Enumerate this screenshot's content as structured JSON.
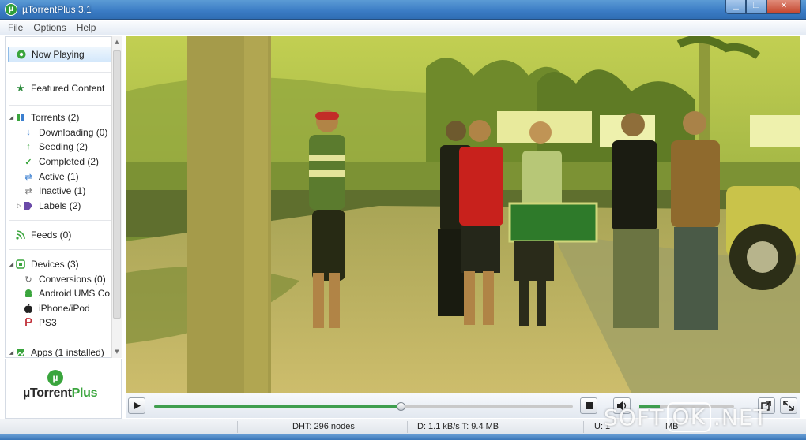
{
  "window": {
    "title": "µTorrentPlus 3.1",
    "app_icon": "utorrent-logo-icon"
  },
  "menu": [
    "File",
    "Options",
    "Help"
  ],
  "sidebar": {
    "now_playing": "Now Playing",
    "featured": "Featured Content",
    "torrents": "Torrents (2)",
    "downloading": "Downloading (0)",
    "seeding": "Seeding (2)",
    "completed": "Completed (2)",
    "active": "Active (1)",
    "inactive": "Inactive (1)",
    "labels": "Labels (2)",
    "feeds": "Feeds (0)",
    "devices": "Devices (3)",
    "conversions": "Conversions (0)",
    "android": "Android UMS Co",
    "iphone": "iPhone/iPod",
    "ps3": "PS3",
    "apps": "Apps (1 installed)"
  },
  "brand": {
    "badge": "µ",
    "name": "µTorrent",
    "plus": "Plus"
  },
  "player": {
    "seek_progress": 0.59,
    "volume_level": 0.22,
    "state": "paused"
  },
  "statusbar": {
    "dht": "DHT: 296 nodes",
    "down": "D: 1.1 kB/s T: 9.4 MB",
    "up": "U: 1",
    "up_total": "MB"
  },
  "watermark": {
    "pre": "SOFT",
    "mid": "OK",
    "post": ".NET"
  },
  "colors": {
    "accent_green": "#3f9e4f",
    "title_blue": "#3a7bc4",
    "selection_border": "#8fbce8"
  }
}
